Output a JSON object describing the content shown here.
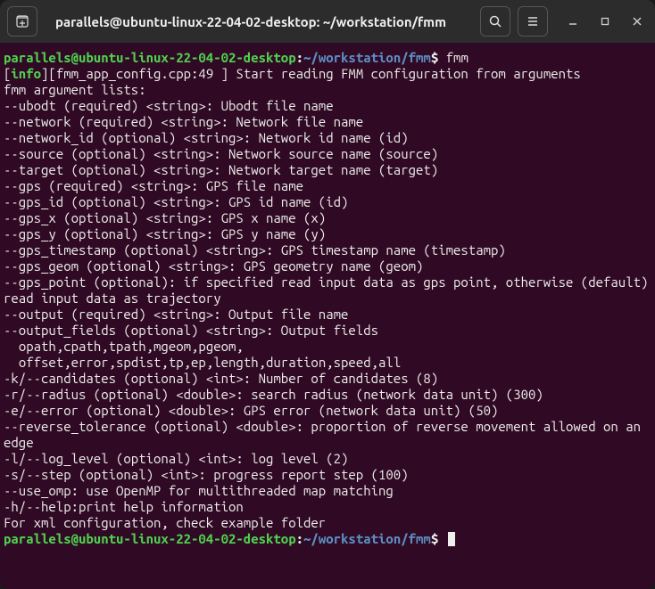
{
  "titlebar": {
    "title": "parallels@ubuntu-linux-22-04-02-desktop: ~/workstation/fmm"
  },
  "prompt1": {
    "user_host": "parallels@ubuntu-linux-22-04-02-desktop",
    "colon": ":",
    "path": "~/workstation/fmm",
    "dollar": "$ ",
    "command": "fmm"
  },
  "output": {
    "info_open": "[",
    "info_tag": "info",
    "info_rest": "][fmm_app_config.cpp:49 ] Start reading FMM configuration from arguments",
    "lines": [
      "fmm argument lists:",
      "--ubodt (required) <string>: Ubodt file name",
      "--network (required) <string>: Network file name",
      "--network_id (optional) <string>: Network id name (id)",
      "--source (optional) <string>: Network source name (source)",
      "--target (optional) <string>: Network target name (target)",
      "--gps (required) <string>: GPS file name",
      "--gps_id (optional) <string>: GPS id name (id)",
      "--gps_x (optional) <string>: GPS x name (x)",
      "--gps_y (optional) <string>: GPS y name (y)",
      "--gps_timestamp (optional) <string>: GPS timestamp name (timestamp)",
      "--gps_geom (optional) <string>: GPS geometry name (geom)",
      "--gps_point (optional): if specified read input data as gps point, otherwise (default) read input data as trajectory",
      "--output (required) <string>: Output file name",
      "--output_fields (optional) <string>: Output fields",
      "  opath,cpath,tpath,mgeom,pgeom,",
      "  offset,error,spdist,tp,ep,length,duration,speed,all",
      "-k/--candidates (optional) <int>: Number of candidates (8)",
      "-r/--radius (optional) <double>: search radius (network data unit) (300)",
      "-e/--error (optional) <double>: GPS error (network data unit) (50)",
      "--reverse_tolerance (optional) <double>: proportion of reverse movement allowed on an edge",
      "-l/--log_level (optional) <int>: log level (2)",
      "-s/--step (optional) <int>: progress report step (100)",
      "--use_omp: use OpenMP for multithreaded map matching",
      "-h/--help:print help information",
      "For xml configuration, check example folder"
    ]
  },
  "prompt2": {
    "user_host": "parallels@ubuntu-linux-22-04-02-desktop",
    "colon": ":",
    "path": "~/workstation/fmm",
    "dollar": "$ "
  }
}
